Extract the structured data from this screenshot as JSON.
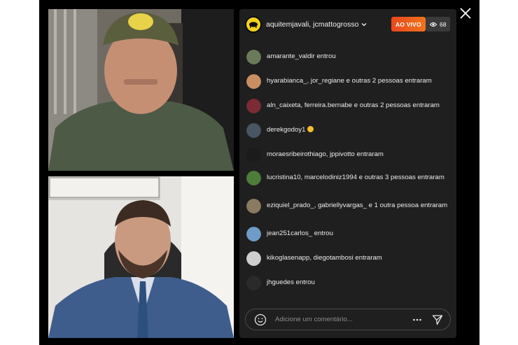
{
  "header": {
    "host_names": "aquitemjavali, jcmattogrosso",
    "live_label": "AO VIVO",
    "viewer_count": "68"
  },
  "feed": [
    {
      "text": "amarante_valdir entrou",
      "avatar_color": "#6b7a5a"
    },
    {
      "text": "hyarabianca_, jor_regiane e outras 2 pessoas entraram",
      "avatar_color": "#c98f63"
    },
    {
      "text": "aln_caixeta, ferreira.bernabe e outras 2 pessoas entraram",
      "avatar_color": "#7a2b33"
    },
    {
      "text": "derekgodoy1",
      "avatar_color": "#4a5563",
      "emoji": "clap"
    },
    {
      "text": "moraesribeirothiago, jppivotto entraram",
      "avatar_color": "#1b1b1b"
    },
    {
      "text": "lucristina10, marcelodiniz1994 e outras 3 pessoas entraram",
      "avatar_color": "#4e7c3b"
    },
    {
      "text": "eziquiel_prado_, gabriellyvargas_ e 1 outra pessoa entraram",
      "avatar_color": "#8a7a62"
    },
    {
      "text": "jean251carlos_ entrou",
      "avatar_color": "#6f9cc7"
    },
    {
      "text": "kikoglasenapp, diegotambosi entraram",
      "avatar_color": "#cfcfcf"
    },
    {
      "text": "jhguedes entrou",
      "avatar_color": "#2a2a2a"
    }
  ],
  "composer": {
    "placeholder": "Adicione um comentário..."
  },
  "icons": {
    "close": "close-icon",
    "eye": "eye-icon",
    "chevron": "chevron-down-icon",
    "emoji": "emoji-icon",
    "more": "more-horizontal-icon",
    "send": "send-icon"
  },
  "colors": {
    "live_gradient_start": "#e8491d",
    "live_gradient_end": "#f0731b",
    "panel_bg": "#1f1f1f",
    "stage_bg": "#000000"
  }
}
